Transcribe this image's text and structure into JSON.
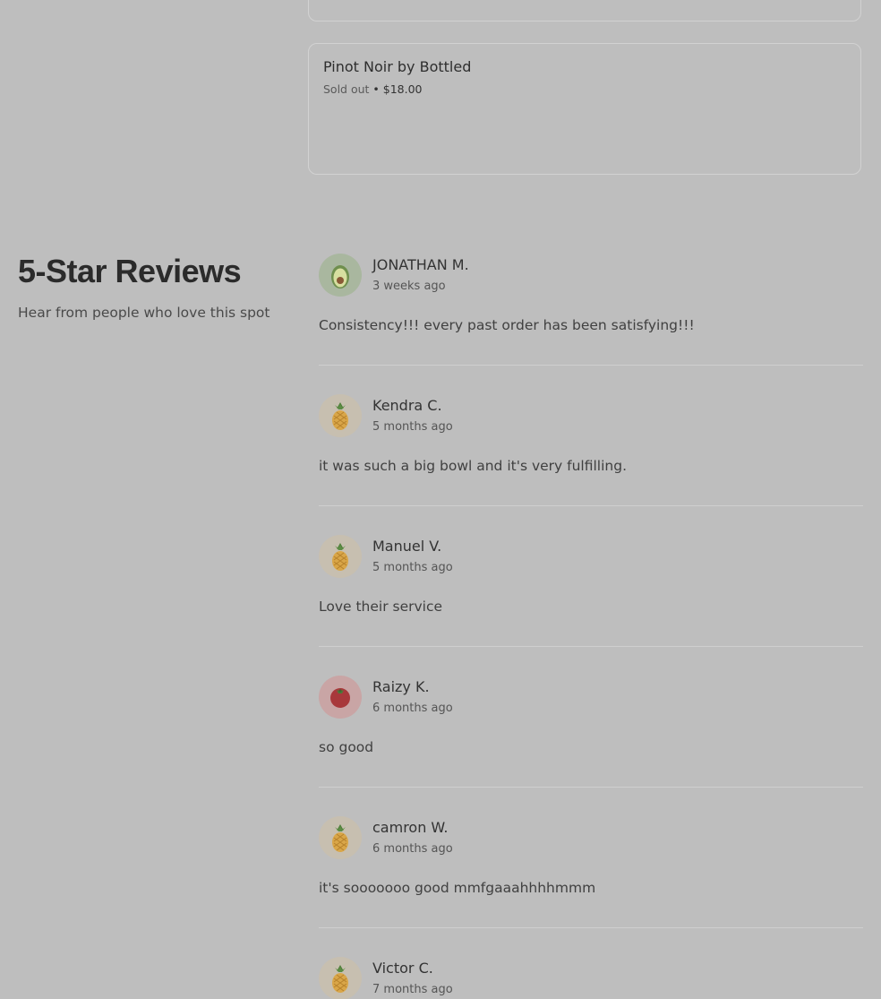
{
  "product": {
    "name": "Pinot Noir by Bottled",
    "status": "Sold out",
    "separator": " • ",
    "price": "$18.00"
  },
  "reviews_section": {
    "title": "5-Star Reviews",
    "subtitle": "Hear from people who love this spot"
  },
  "reviews": [
    {
      "name": "JONATHAN M.",
      "time": "3 weeks ago",
      "text": "Consistency!!! every past order has been satisfying!!!",
      "avatar": "avocado-icon"
    },
    {
      "name": "Kendra C.",
      "time": "5 months ago",
      "text": "it was such a big bowl and it's very fulfilling.",
      "avatar": "pineapple-icon"
    },
    {
      "name": "Manuel V.",
      "time": "5 months ago",
      "text": "Love their service",
      "avatar": "pineapple-icon"
    },
    {
      "name": "Raizy K.",
      "time": "6 months ago",
      "text": "so good",
      "avatar": "tomato-icon"
    },
    {
      "name": "camron W.",
      "time": "6 months ago",
      "text": "it's sooooooo good mmfgaaahhhhmmm",
      "avatar": "pineapple-icon"
    },
    {
      "name": "Victor C.",
      "time": "7 months ago",
      "text": "",
      "avatar": "pineapple-icon"
    }
  ]
}
